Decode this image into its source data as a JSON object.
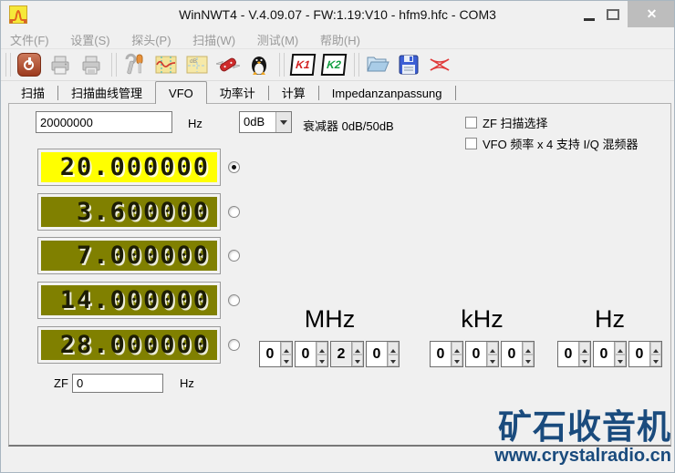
{
  "window": {
    "title": "WinNWT4 - V.4.09.07 - FW:1.19:V10 - hfm9.hfc - COM3"
  },
  "menu": {
    "items": [
      "文件(F)",
      "设置(S)",
      "探头(P)",
      "扫描(W)",
      "测试(M)",
      "帮助(H)"
    ]
  },
  "toolbar": {
    "icons": [
      "power-exit",
      "print",
      "print-2",
      "settings-tools",
      "sweep-display",
      "db-scale",
      "swiss-knife",
      "linux-penguin",
      "channel-k1",
      "channel-k2",
      "open-file",
      "save-file",
      "calibration"
    ],
    "k1_label": "K1",
    "k2_label": "K2"
  },
  "tabs": [
    {
      "label": "扫描",
      "active": false
    },
    {
      "label": "扫描曲线管理",
      "active": false
    },
    {
      "label": "VFO",
      "active": true
    },
    {
      "label": "功率计",
      "active": false
    },
    {
      "label": "计算",
      "active": false
    },
    {
      "label": "Impedanzanpassung",
      "active": false
    }
  ],
  "vfo": {
    "freq_value": "20000000",
    "freq_unit": "Hz",
    "attenuator_value": "0dB",
    "attenuator_label": "衰减器 0dB/50dB",
    "checkboxes": [
      {
        "label": "ZF 扫描选择",
        "checked": false
      },
      {
        "label": "VFO 频率 x 4 支持 I/Q 混频器",
        "checked": false
      }
    ],
    "lcds": [
      {
        "value": "20.000000",
        "selected": true,
        "bg": "#ffff00"
      },
      {
        "value": "3.600000",
        "selected": false,
        "bg": "#808000"
      },
      {
        "value": "7.000000",
        "selected": false,
        "bg": "#808000"
      },
      {
        "value": "14.000000",
        "selected": false,
        "bg": "#808000"
      },
      {
        "value": "28.000000",
        "selected": false,
        "bg": "#808000"
      }
    ],
    "zf_label": "ZF",
    "zf_value": "0",
    "zf_unit": "Hz",
    "spinner_groups": [
      {
        "label": "MHz",
        "digits": [
          "0",
          "0",
          "2",
          "0"
        ]
      },
      {
        "label": "kHz",
        "digits": [
          "0",
          "0",
          "0"
        ]
      },
      {
        "label": "Hz",
        "digits": [
          "0",
          "0",
          "0"
        ]
      }
    ]
  },
  "watermark": {
    "title": "矿石收音机",
    "url": "www.crystalradio.cn"
  },
  "colors": {
    "lcd_active_bg": "#ffff00",
    "lcd_inactive_bg": "#808000",
    "watermark_blue": "#1a4b7d"
  }
}
